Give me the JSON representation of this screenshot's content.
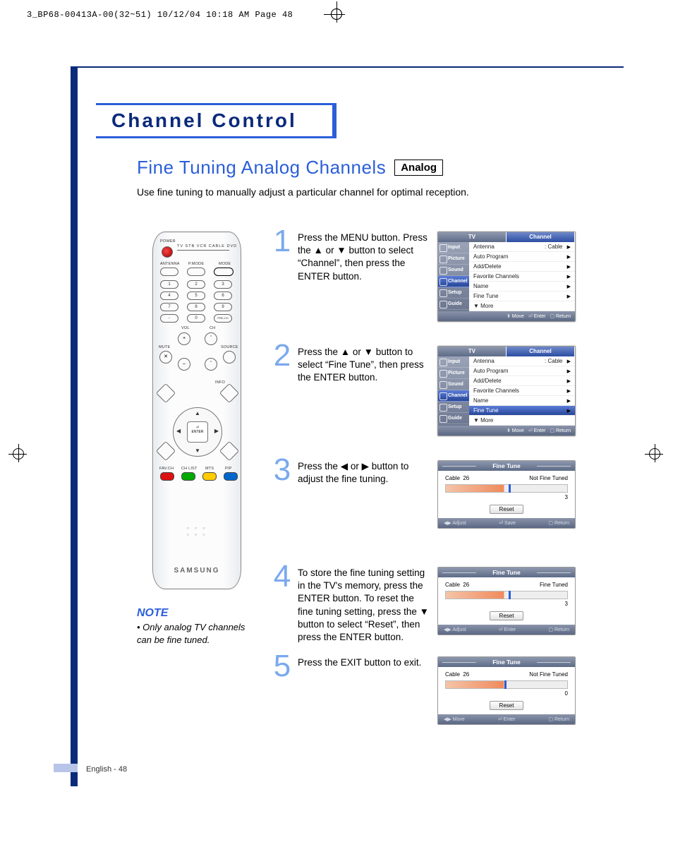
{
  "printHeader": "3_BP68-00413A-00(32~51)  10/12/04  10:18 AM  Page 48",
  "sectionTitle": "Channel Control",
  "subtitle": "Fine Tuning Analog Channels",
  "analogBadge": "Analog",
  "intro": "Use fine tuning to manually adjust a particular channel for optimal reception.",
  "noteHead": "NOTE",
  "noteBody": "Only analog TV channels can be fine tuned.",
  "remote": {
    "power": "POWER",
    "antenna": "ANTENNA",
    "pmode": "P.MODE",
    "mode": "MODE",
    "topBar": "TV   STB   VCR  CABLE  DVD",
    "vol": "VOL",
    "ch": "CH",
    "mute": "MUTE",
    "source": "SOURCE",
    "precn": "PRE-CH",
    "info": "INFO",
    "enter": "ENTER",
    "favch": "FAV.CH",
    "chlist": "CH LIST",
    "mts": "MTS",
    "pip": "PIP",
    "brand": "SAMSUNG"
  },
  "steps": [
    {
      "num": "1",
      "text": "Press the MENU button. Press the ▲ or ▼ button to select “Channel”, then press the ENTER button."
    },
    {
      "num": "2",
      "text": "Press the ▲ or ▼ button to select “Fine Tune”, then press the ENTER button."
    },
    {
      "num": "3",
      "text": "Press the ◀ or ▶ button to adjust the fine tuning."
    },
    {
      "num": "4",
      "text": "To store the fine tuning setting in the TV's memory, press the ENTER button. To reset the fine tuning setting, press the ▼ button to select “Reset”, then press the ENTER button."
    },
    {
      "num": "5",
      "text": "Press the EXIT button to exit."
    }
  ],
  "osdMenu": {
    "tabs": [
      "TV",
      "Channel"
    ],
    "left": [
      "Input",
      "Picture",
      "Sound",
      "Channel",
      "Setup",
      "Guide"
    ],
    "rows": [
      {
        "label": "Antenna",
        "value": ": Cable"
      },
      {
        "label": "Auto Program",
        "value": ""
      },
      {
        "label": "Add/Delete",
        "value": ""
      },
      {
        "label": "Favorite Channels",
        "value": ""
      },
      {
        "label": "Name",
        "value": ""
      },
      {
        "label": "Fine Tune",
        "value": ""
      },
      {
        "label": "▼ More",
        "value": ""
      }
    ],
    "footMove": "Move",
    "footEnter": "Enter",
    "footReturn": "Return"
  },
  "ft": {
    "title": "Fine Tune",
    "cable": "Cable",
    "ch": "26",
    "notTuned": "Not Fine Tuned",
    "tuned": "Fine Tuned",
    "reset": "Reset",
    "adjust": "Adjust",
    "save": "Save",
    "enter": "Enter",
    "return": "Return",
    "move": "Move",
    "screens": [
      {
        "status": "Not Fine Tuned",
        "val": "3",
        "tick": 52,
        "foot": [
          "Adjust",
          "Save",
          "Return"
        ]
      },
      {
        "status": "Fine Tuned",
        "val": "3",
        "tick": 52,
        "foot": [
          "Adjust",
          "Enter",
          "Return"
        ]
      },
      {
        "status": "Not Fine Tuned",
        "val": "0",
        "tick": 48,
        "foot": [
          "Move",
          "Enter",
          "Return"
        ]
      }
    ]
  },
  "pageFoot": "English - 48"
}
